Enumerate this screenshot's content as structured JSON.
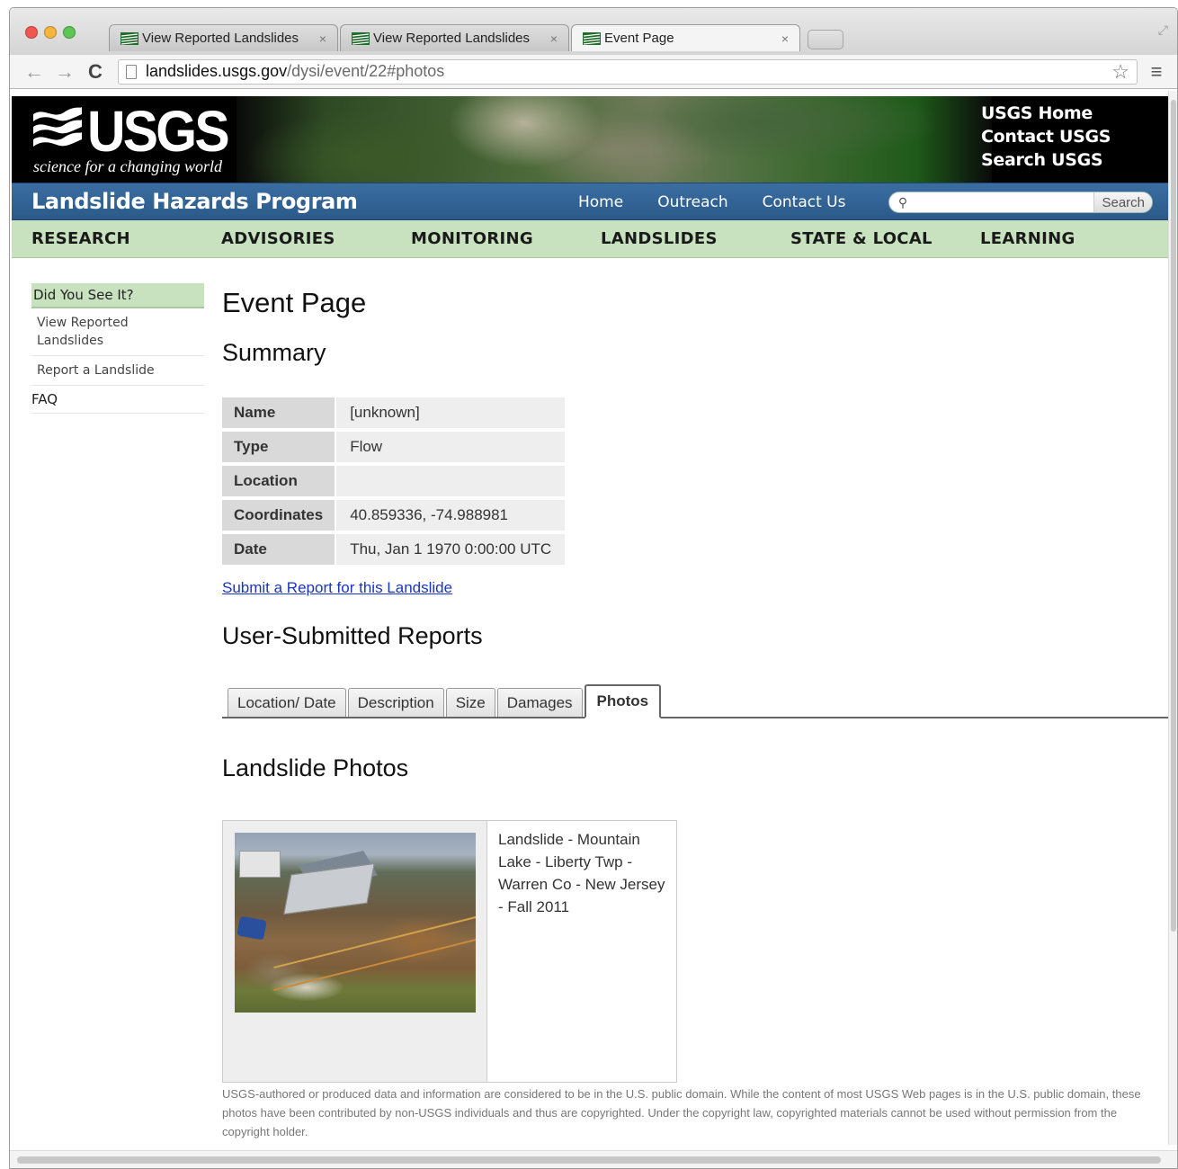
{
  "browser": {
    "tabs": [
      {
        "title": "View Reported Landslides",
        "close": "×"
      },
      {
        "title": "View Reported Landslides",
        "close": "×"
      },
      {
        "title": "Event Page",
        "close": "×"
      }
    ],
    "address": {
      "host": "landslides.usgs.gov",
      "path": "/dysi/event/22#photos"
    },
    "back_icon": "←",
    "forward_icon": "→",
    "reload_icon": "C",
    "bookmark_icon": "☆",
    "menu_icon": "≡"
  },
  "banner": {
    "logo_text": "USGS",
    "tagline": "science for a changing world",
    "links": [
      "USGS Home",
      "Contact USGS",
      "Search USGS"
    ]
  },
  "program_bar": {
    "title": "Landslide Hazards Program",
    "nav": [
      "Home",
      "Outreach",
      "Contact Us"
    ],
    "search_placeholder": "",
    "search_button": "Search"
  },
  "main_nav": [
    "RESEARCH",
    "ADVISORIES",
    "MONITORING",
    "LANDSLIDES",
    "STATE & LOCAL",
    "LEARNING"
  ],
  "sidebar": {
    "header": "Did You See It?",
    "items": [
      "View Reported Landslides",
      "Report a Landslide"
    ],
    "faq": "FAQ"
  },
  "content": {
    "page_title": "Event Page",
    "summary_heading": "Summary",
    "summary": [
      {
        "label": "Name",
        "value": "[unknown]"
      },
      {
        "label": "Type",
        "value": "Flow"
      },
      {
        "label": "Location",
        "value": ""
      },
      {
        "label": "Coordinates",
        "value": "40.859336, -74.988981"
      },
      {
        "label": "Date",
        "value": "Thu, Jan 1 1970 0:00:00 UTC"
      }
    ],
    "report_link": "Submit a Report for this Landslide",
    "reports_heading": "User-Submitted Reports",
    "report_tabs": [
      "Location/ Date",
      "Description",
      "Size",
      "Damages",
      "Photos"
    ],
    "active_tab": "Photos",
    "photos_heading": "Landslide Photos",
    "photo_caption": "Landslide - Mountain Lake - Liberty Twp - Warren Co - New Jersey - Fall 2011",
    "disclaimer": "USGS-authored or produced data and information are considered to be in the U.S. public domain. While the content of most USGS Web pages is in the U.S. public domain, these photos have been contributed by non-USGS individuals and thus are copyrighted. Under the copyright law, copyrighted materials cannot be used without permission from the copyright holder."
  },
  "colors": {
    "program_bar": "#2f5f90",
    "main_nav": "#c8e2c0",
    "link": "#1a35c4"
  }
}
